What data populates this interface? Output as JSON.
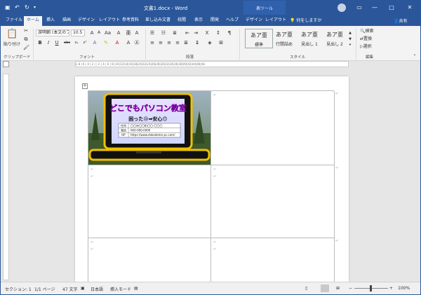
{
  "app": {
    "doc_title": "文書1.docx - Word",
    "context_tab": "表ツール",
    "tell_me": "何をしますか",
    "share": "共有"
  },
  "tabs": [
    "ファイル",
    "ホーム",
    "挿入",
    "描画",
    "デザイン",
    "レイアウト",
    "参考資料",
    "差し込み文書",
    "校閲",
    "表示",
    "開発",
    "ヘルプ",
    "デザイン",
    "レイアウト"
  ],
  "ribbon": {
    "clipboard": {
      "paste": "貼り付け",
      "label": "クリップボード"
    },
    "font": {
      "name": "游明朝 (本文のフ",
      "size": "10.5",
      "label": "フォント"
    },
    "paragraph": {
      "label": "段落"
    },
    "styles": {
      "label": "スタイル",
      "items": [
        {
          "sample": "あア亜",
          "name": "標準"
        },
        {
          "sample": "あア亜",
          "name": "行間詰め"
        },
        {
          "sample": "あア亜",
          "name": "見出し 1"
        },
        {
          "sample": "あア亜",
          "name": "見出し 2"
        }
      ]
    },
    "editing": {
      "label": "編集",
      "find": "検索",
      "replace": "置換",
      "select": "選択"
    }
  },
  "ruler": "L  8 | 6 | 4 | 2 |  | 2 | 4 | 6 | 8 |10|12|14|16|18|20|22|24|26|28|30|32|34|36|38|40|42|44|46|48",
  "card": {
    "title": "どこでもパソコン教室",
    "subtitle": "困った😢➡安心😊",
    "rows": [
      {
        "k": "住所",
        "v": "〇〇市〇〇町〇〇-〇〇〇"
      },
      {
        "k": "電話",
        "v": "000-000-0000"
      },
      {
        "k": "HP",
        "v": "https://www.dokodemo-pc.com/"
      }
    ]
  },
  "para_mark": "↵",
  "status": {
    "section": "セクション: 1",
    "page": "1/1 ページ",
    "words": "47 文字",
    "lang": "日本語",
    "mode": "挿入モード",
    "zoom": "100%"
  },
  "colors": {
    "accent": "#2b579a",
    "laptop": "#f0c000",
    "card_title": "#ff3eb5"
  }
}
